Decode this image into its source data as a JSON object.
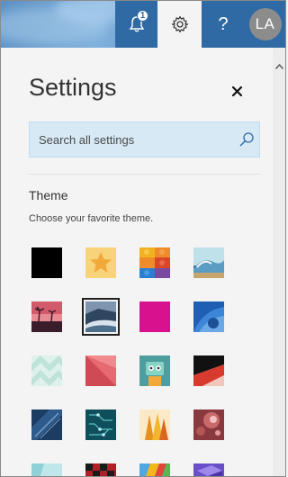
{
  "header": {
    "notification_count": "1",
    "help_label": "?",
    "avatar_initials": "LA"
  },
  "settings": {
    "title": "Settings",
    "search_placeholder": "Search all settings",
    "theme_heading": "Theme",
    "theme_subtitle": "Choose your favorite theme."
  },
  "themes": {
    "selected_index": 5,
    "items": [
      {
        "name": "black",
        "color": "#000000"
      },
      {
        "name": "stars",
        "color": "#f6c65b"
      },
      {
        "name": "bricks",
        "color": "#e8832a"
      },
      {
        "name": "wave",
        "color": "#8fc4d8"
      },
      {
        "name": "sunset-palms",
        "color": "#c85a65"
      },
      {
        "name": "coast",
        "color": "#35506a"
      },
      {
        "name": "magenta",
        "color": "#d8128f"
      },
      {
        "name": "blue-swirl",
        "color": "#2b6fc0"
      },
      {
        "name": "mint-chevron",
        "color": "#cfe9e3"
      },
      {
        "name": "coral-geo",
        "color": "#dd5a63"
      },
      {
        "name": "robot",
        "color": "#69c3b8"
      },
      {
        "name": "red-fold",
        "color": "#d83a2e"
      },
      {
        "name": "dark-blue-tech",
        "color": "#1f4e79"
      },
      {
        "name": "circuit",
        "color": "#14606b"
      },
      {
        "name": "cones",
        "color": "#e9a52a"
      },
      {
        "name": "bokeh",
        "color": "#a3484b"
      },
      {
        "name": "cyan-fade",
        "color": "#8fd1d7"
      },
      {
        "name": "red-check",
        "color": "#c8242c"
      },
      {
        "name": "rainbow-blocks",
        "color": "#f4b61b"
      },
      {
        "name": "purple-cube",
        "color": "#7a5fd6"
      }
    ]
  }
}
